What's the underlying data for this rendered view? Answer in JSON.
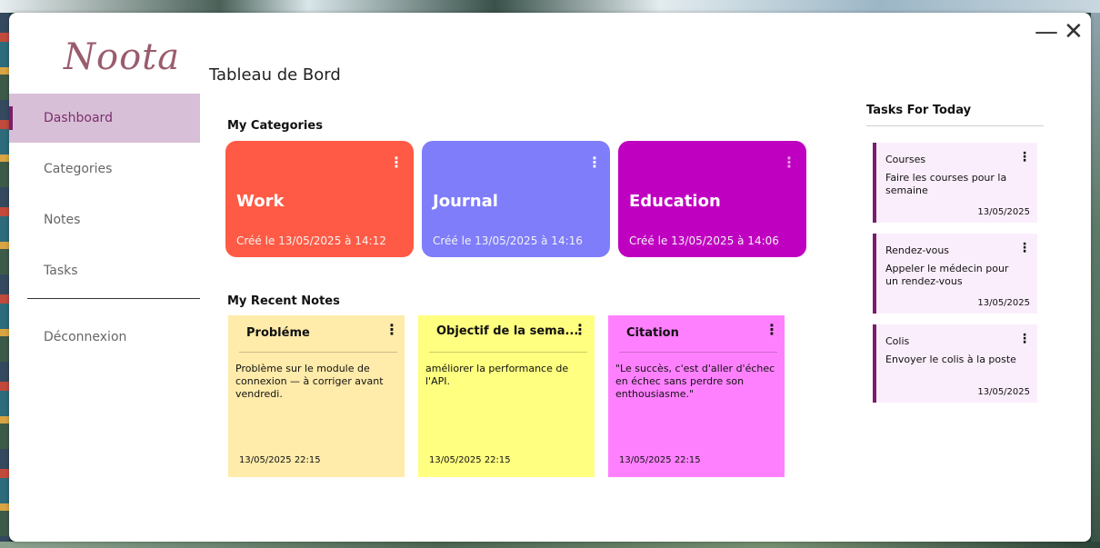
{
  "app": {
    "logo": "Noota"
  },
  "window_controls": {
    "minimize": "—",
    "close": "✕"
  },
  "sidebar": {
    "items": [
      {
        "label": "Dashboard",
        "active": true
      },
      {
        "label": "Categories",
        "active": false
      },
      {
        "label": "Notes",
        "active": false
      },
      {
        "label": "Tasks",
        "active": false
      }
    ],
    "logout": "Déconnexion"
  },
  "main": {
    "title": "Tableau de Bord",
    "categories_title": "My Categories",
    "categories": [
      {
        "name": "Work",
        "created": "Créé le 13/05/2025 à 14:12",
        "color": "#ff5a45"
      },
      {
        "name": "Journal",
        "created": "Créé le 13/05/2025 à 14:16",
        "color": "#7f7dfa"
      },
      {
        "name": "Education",
        "created": "Créé le 13/05/2025 à 14:06",
        "color": "#c000c0"
      }
    ],
    "notes_title": "My Recent Notes",
    "notes": [
      {
        "title": "Probléme",
        "body": "Problème sur le module de connexion — à corriger avant vendredi.",
        "date": "13/05/2025 22:15",
        "color": "#ffebaa"
      },
      {
        "title": "Objectif de la sema...",
        "body": "améliorer la performance de l'API.",
        "date": "13/05/2025 22:15",
        "color": "#ffff80"
      },
      {
        "title": "Citation",
        "body": "\"Le succès, c'est d'aller d'échec en échec sans perdre son enthousiasme.\"",
        "date": "13/05/2025 22:15",
        "color": "#ff80ff"
      }
    ]
  },
  "tasks": {
    "title": "Tasks For Today",
    "items": [
      {
        "title": "Courses",
        "desc": "Faire les courses pour la semaine",
        "date": "13/05/2025"
      },
      {
        "title": "Rendez-vous",
        "desc": "Appeler le médecin pour un rendez-vous",
        "date": "13/05/2025"
      },
      {
        "title": "Colis",
        "desc": "Envoyer le colis à la poste",
        "date": "13/05/2025"
      }
    ]
  },
  "icons": {
    "kebab": "⋮"
  },
  "colors": {
    "accent": "#7a1f6b",
    "active_nav_bg": "#d8bfd8",
    "task_bg": "#fbeefc"
  }
}
